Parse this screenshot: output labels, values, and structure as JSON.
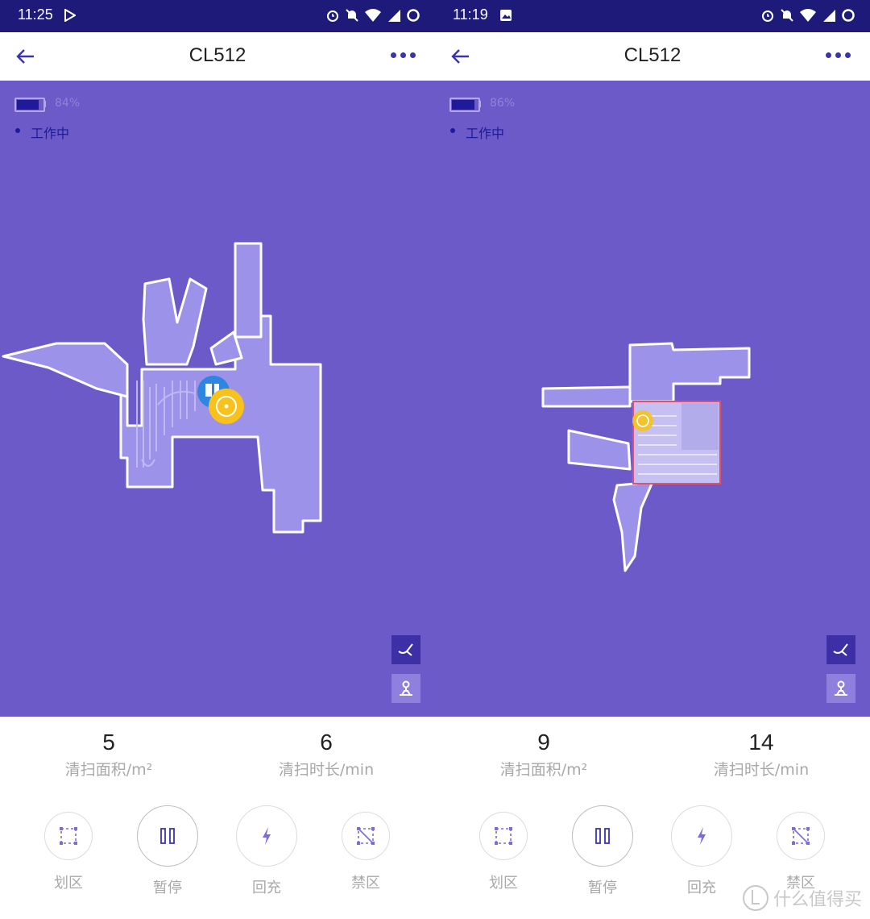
{
  "panels": [
    {
      "status_time": "11:25",
      "title": "CL512",
      "battery_percent": "84%",
      "battery_level": 0.84,
      "state": "工作中",
      "stats": [
        {
          "value": "5",
          "label": "清扫面积/m²"
        },
        {
          "value": "6",
          "label": "清扫时长/min"
        }
      ],
      "controls": [
        {
          "label": "划区",
          "icon": "zone-select-icon"
        },
        {
          "label": "暂停",
          "icon": "pause-icon"
        },
        {
          "label": "回充",
          "icon": "recharge-icon"
        },
        {
          "label": "禁区",
          "icon": "forbidden-zone-icon"
        }
      ]
    },
    {
      "status_time": "11:19",
      "title": "CL512",
      "battery_percent": "86%",
      "battery_level": 0.86,
      "state": "工作中",
      "stats": [
        {
          "value": "9",
          "label": "清扫面积/m²"
        },
        {
          "value": "14",
          "label": "清扫时长/min"
        }
      ],
      "controls": [
        {
          "label": "划区",
          "icon": "zone-select-icon"
        },
        {
          "label": "暂停",
          "icon": "pause-icon"
        },
        {
          "label": "回充",
          "icon": "recharge-icon"
        },
        {
          "label": "禁区",
          "icon": "forbidden-zone-icon"
        }
      ]
    }
  ],
  "watermark": "什么值得买",
  "colors": {
    "status_bar": "#1e1a7a",
    "map_background": "#6b5ac8",
    "map_area": "#9d92ea",
    "accent": "#3a34b0",
    "robot": "#f7c21b",
    "dock": "#2f86e0",
    "zone_outline": "#e0506a"
  }
}
